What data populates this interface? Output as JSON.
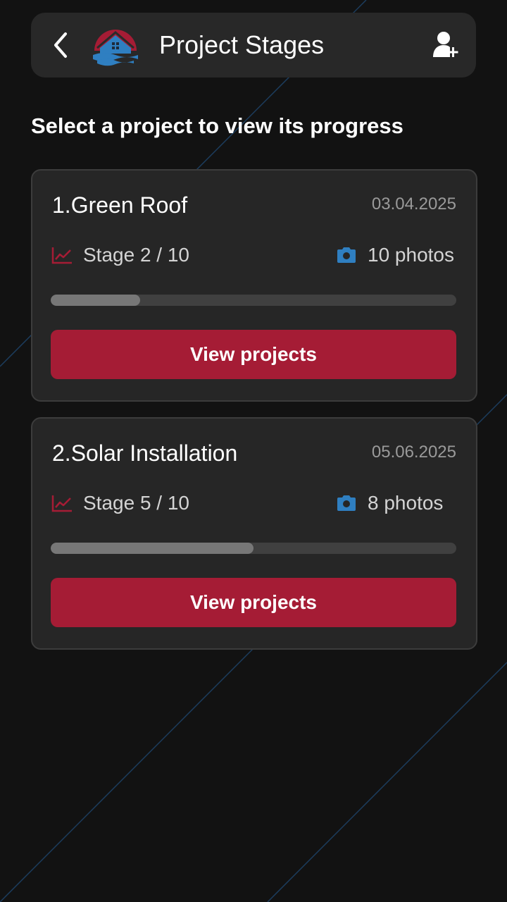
{
  "header": {
    "title": "Project Stages",
    "back_icon": "chevron-left-icon",
    "logo": "house-logo",
    "action_icon": "add-user-icon"
  },
  "subtitle": "Select a project to view its progress",
  "projects": [
    {
      "title": "1.Green Roof",
      "date": "03.04.2025",
      "stage": "Stage 2 / 10",
      "photos": "10 photos",
      "progress": 0.22,
      "button_label": "View projects"
    },
    {
      "title": "2.Solar Installation",
      "date": "05.06.2025",
      "stage": "Stage 5 / 10",
      "photos": "8 photos",
      "progress": 0.5,
      "button_label": "View projects"
    }
  ],
  "colors": {
    "background": "#121212",
    "surface": "#262626",
    "accent": "#a51c35",
    "icon_stage": "#a51c35",
    "icon_photos": "#2f7fc1",
    "progress_track": "#404040",
    "progress_fill": "#777777"
  }
}
